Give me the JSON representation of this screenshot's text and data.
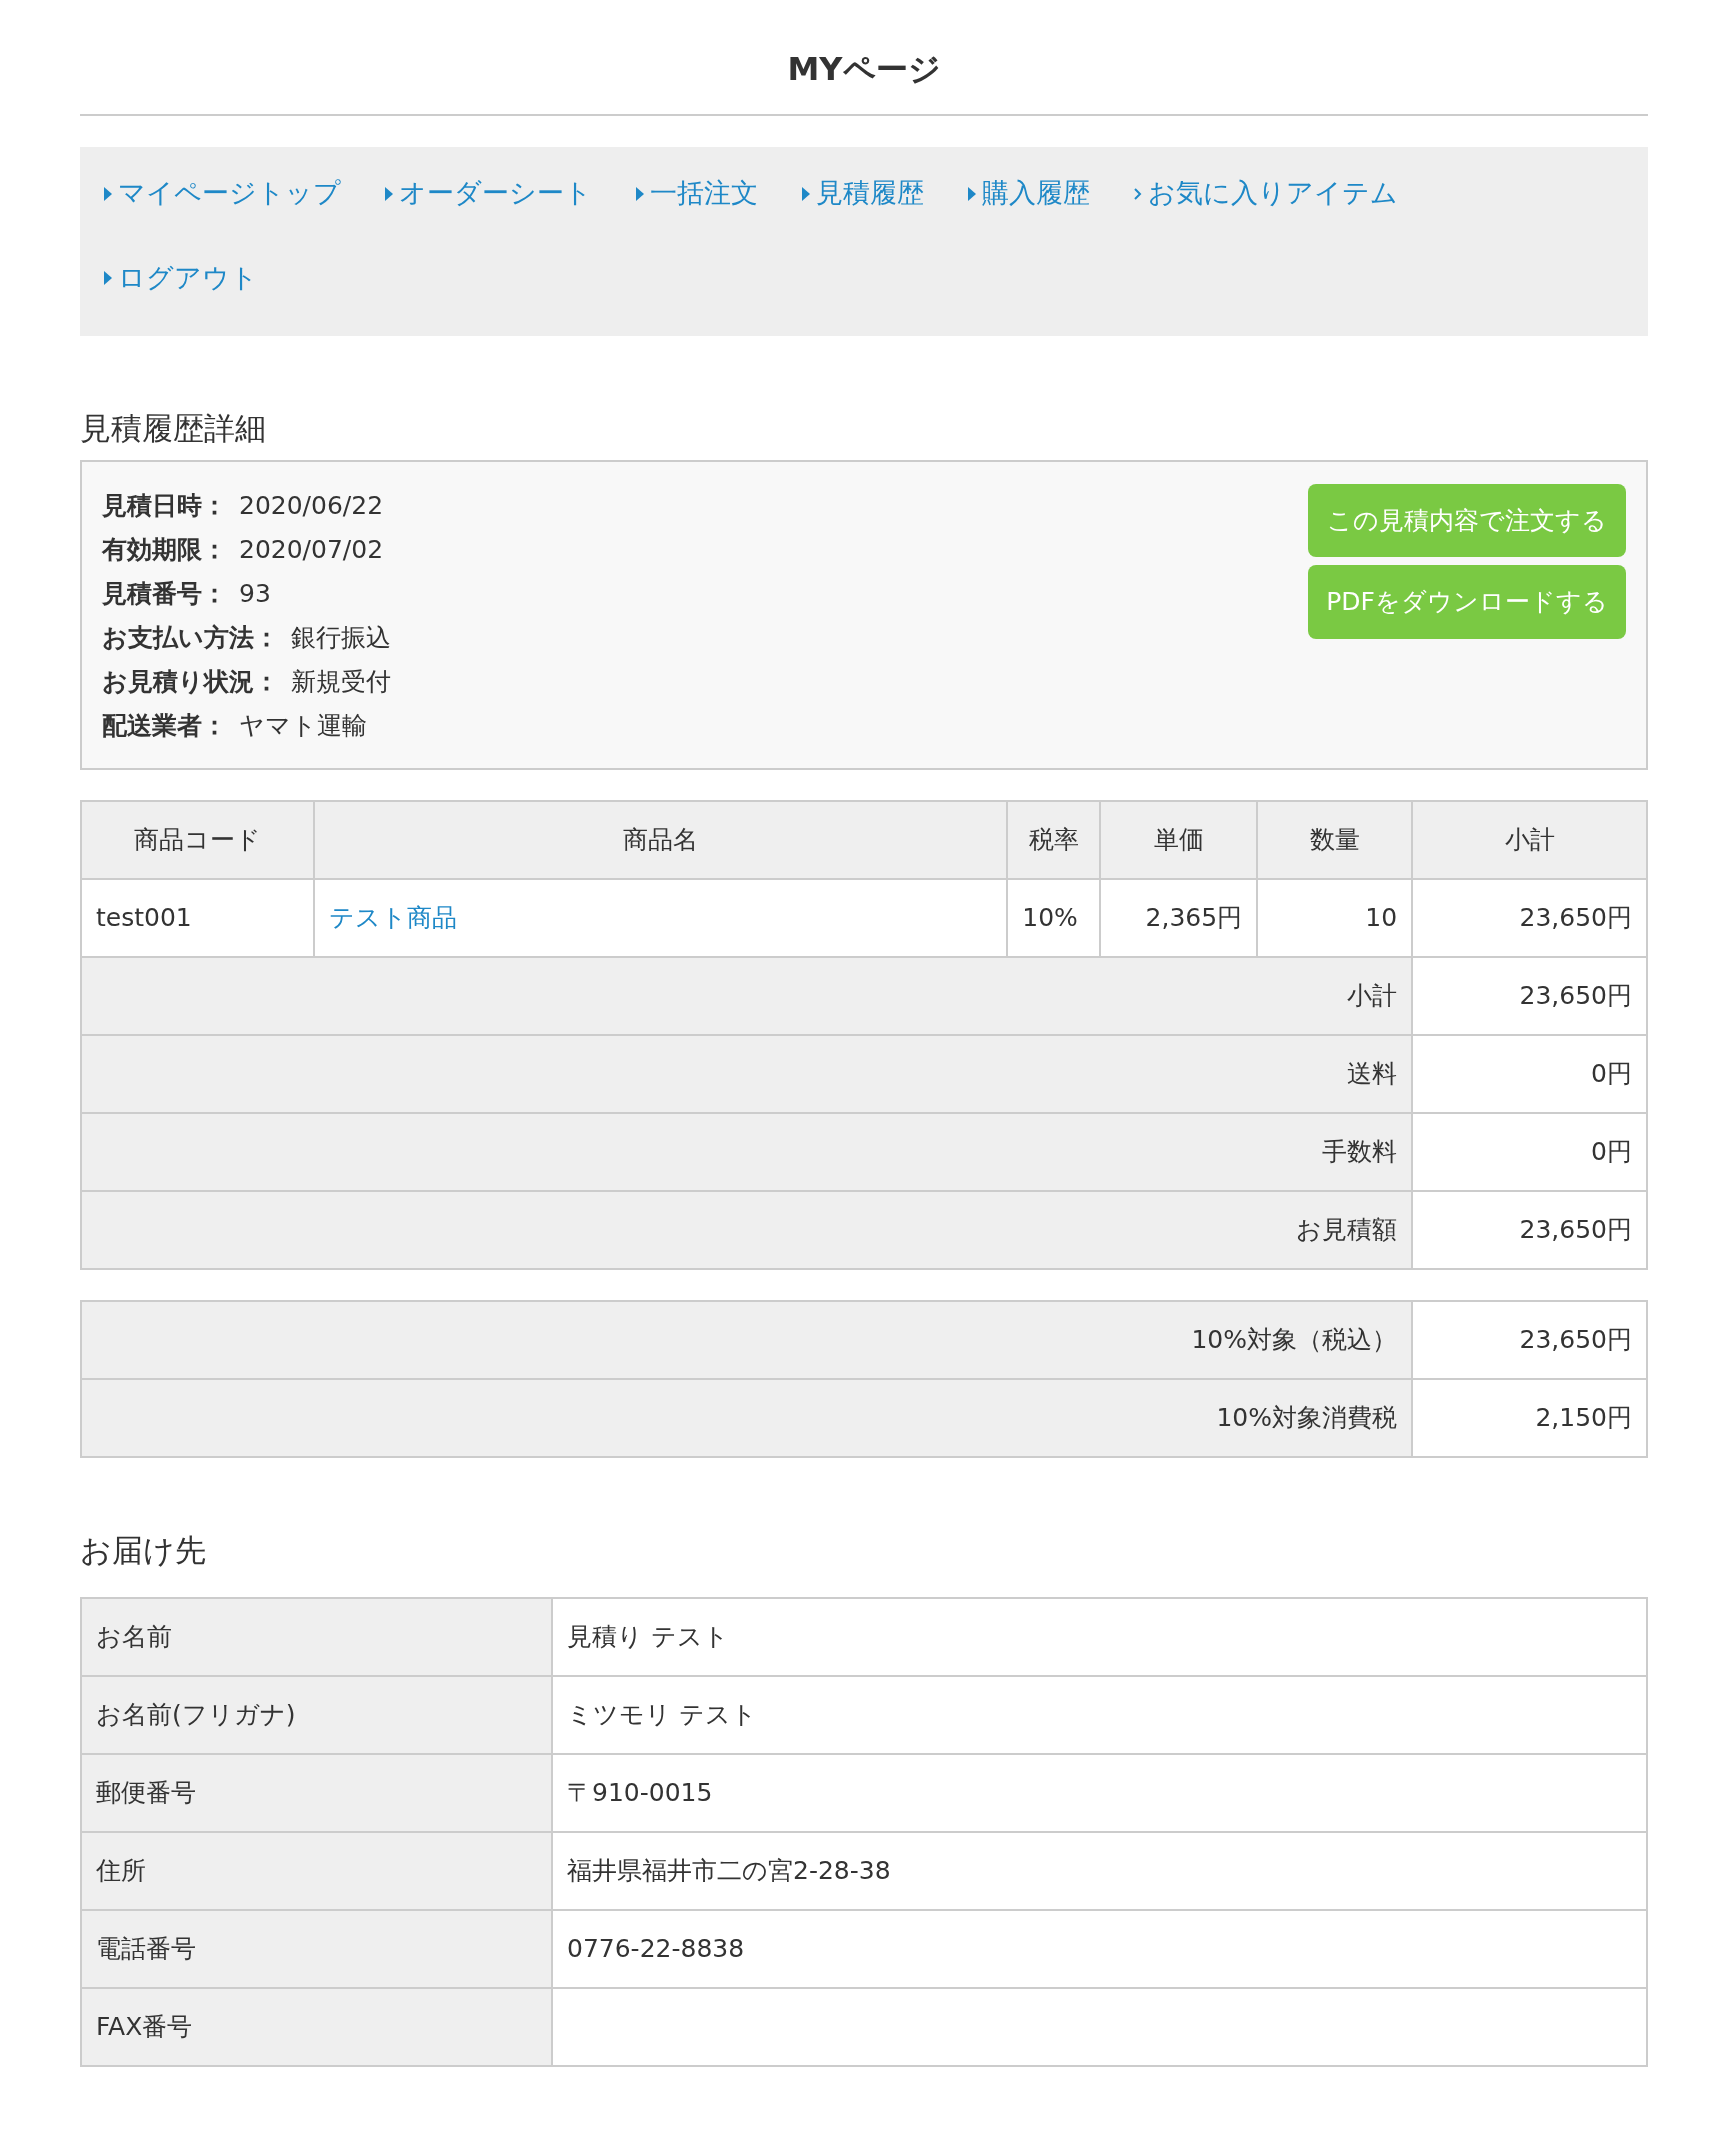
{
  "page_title": "MYページ",
  "nav": [
    {
      "label": "マイページトップ",
      "kind": "triangle"
    },
    {
      "label": "オーダーシート",
      "kind": "triangle"
    },
    {
      "label": "一括注文",
      "kind": "triangle"
    },
    {
      "label": "見積履歴",
      "kind": "triangle"
    },
    {
      "label": "購入履歴",
      "kind": "triangle"
    },
    {
      "label": "お気に入りアイテム",
      "kind": "chevron"
    },
    {
      "label": "ログアウト",
      "kind": "triangle"
    }
  ],
  "detail_heading": "見積履歴詳細",
  "info": [
    {
      "label": "見積日時：",
      "value": "2020/06/22"
    },
    {
      "label": "有効期限：",
      "value": "2020/07/02"
    },
    {
      "label": "見積番号：",
      "value": "93"
    },
    {
      "label": "お支払い方法：",
      "value": "銀行振込"
    },
    {
      "label": "お見積り状況：",
      "value": "新規受付"
    },
    {
      "label": "配送業者：",
      "value": "ヤマト運輸"
    }
  ],
  "buttons": [
    "この見積内容で注文する",
    "PDFをダウンロードする"
  ],
  "items_table": {
    "columns": [
      "商品コード",
      "商品名",
      "税率",
      "単価",
      "数量",
      "小計"
    ],
    "rows": [
      {
        "code": "test001",
        "name": "テスト商品",
        "tax_rate": "10%",
        "unit_price": "2,365円",
        "quantity": "10",
        "subtotal": "23,650円"
      }
    ],
    "totals": [
      {
        "label": "小計",
        "value": "23,650円"
      },
      {
        "label": "送料",
        "value": "0円"
      },
      {
        "label": "手数料",
        "value": "0円"
      },
      {
        "label": "お見積額",
        "value": "23,650円"
      }
    ]
  },
  "tax_table": [
    {
      "label": "10%対象（税込）",
      "value": "23,650円"
    },
    {
      "label": "10%対象消費税",
      "value": "2,150円"
    }
  ],
  "delivery_heading": "お届け先",
  "delivery": [
    {
      "label": "お名前",
      "value": "見積り テスト"
    },
    {
      "label": "お名前(フリガナ)",
      "value": "ミツモリ テスト"
    },
    {
      "label": "郵便番号",
      "value": "〒910-0015"
    },
    {
      "label": "住所",
      "value": "福井県福井市二の宮2-28-38"
    },
    {
      "label": "電話番号",
      "value": "0776-22-8838"
    },
    {
      "label": "FAX番号"
    }
  ]
}
